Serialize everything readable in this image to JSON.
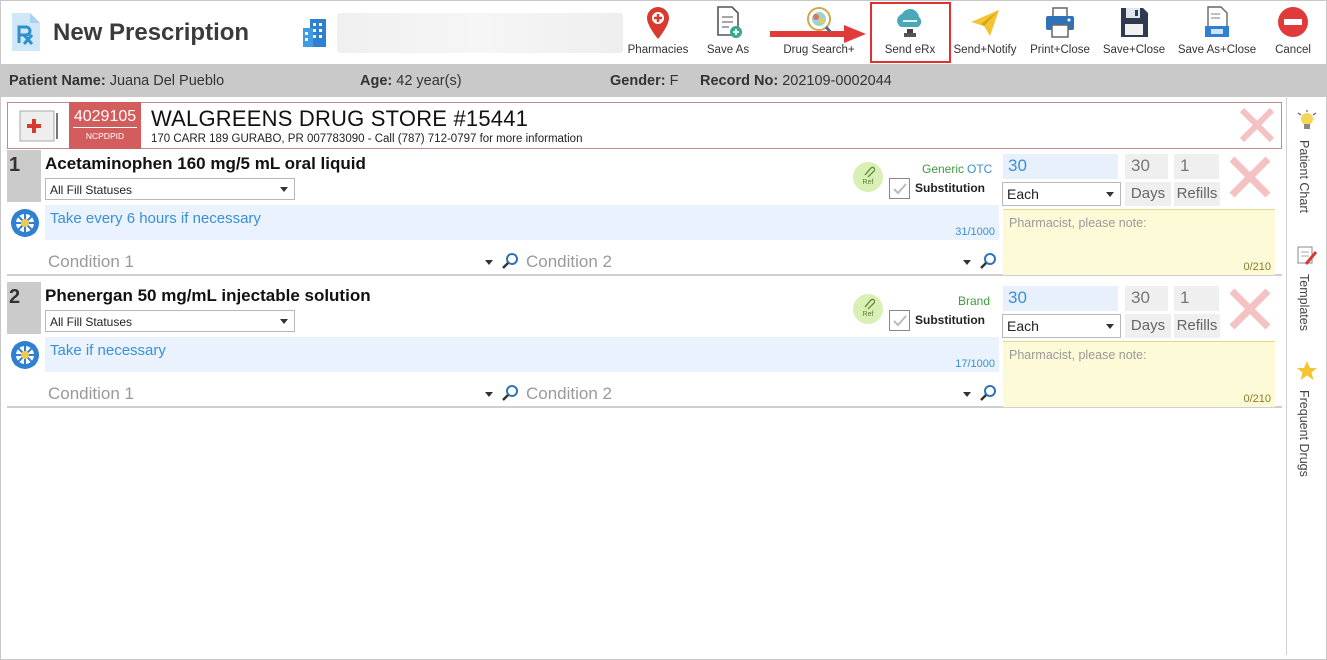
{
  "header": {
    "title": "New Prescription",
    "app_icon": "prescription-app-icon",
    "practice_icon": "building-icon"
  },
  "toolbar": [
    {
      "id": "pharmacies",
      "label": "Pharmacies",
      "icon": "location-pin-icon"
    },
    {
      "id": "save-as",
      "label": "Save As",
      "icon": "document-add-icon"
    },
    {
      "id": "drug-search",
      "label": "Drug Search+",
      "icon": "pill-search-icon"
    },
    {
      "id": "send-erx",
      "label": "Send eRx",
      "icon": "cloud-send-icon",
      "highlighted": true
    },
    {
      "id": "send-notify",
      "label": "Send+Notify",
      "icon": "paper-plane-icon"
    },
    {
      "id": "print-close",
      "label": "Print+Close",
      "icon": "printer-icon"
    },
    {
      "id": "save-close",
      "label": "Save+Close",
      "icon": "floppy-disk-icon"
    },
    {
      "id": "save-as-close",
      "label": "Save As+Close",
      "icon": "document-save-icon"
    },
    {
      "id": "cancel",
      "label": "Cancel",
      "icon": "cancel-circle-icon"
    }
  ],
  "patient": {
    "name_label": "Patient Name:",
    "name": "Juana Del Pueblo",
    "age_label": "Age:",
    "age": "42 year(s)",
    "gender_label": "Gender:",
    "gender": "F",
    "record_label": "Record No:",
    "record": "202109-0002044"
  },
  "pharmacy": {
    "ncpdp_id": "4029105",
    "ncpdp_label": "NCPDPID",
    "name": "WALGREENS DRUG STORE #15441",
    "address": "170 CARR 189 GURABO, PR 007783090 - Call (787) 712-0797 for more information"
  },
  "prescriptions": [
    {
      "number": "1",
      "drug": "Acetaminophen 160 mg/5 mL oral liquid",
      "fill_status": "All Fill Statuses",
      "sig": "Take every 6 hours if necessary",
      "sig_count": "31/1000",
      "condition1": "Condition 1",
      "condition2": "Condition 2",
      "ref_label": "Ref",
      "type_label": "Generic",
      "otc_label": "OTC",
      "substitution_label": "Substitution",
      "quantity": "30",
      "days": "30",
      "refills": "1",
      "unit": "Each",
      "days_label": "Days",
      "refills_label": "Refills",
      "note_placeholder": "Pharmacist, please note:",
      "note_count": "0/210"
    },
    {
      "number": "2",
      "drug": "Phenergan 50 mg/mL injectable solution",
      "fill_status": "All Fill Statuses",
      "sig": "Take if necessary",
      "sig_count": "17/1000",
      "condition1": "Condition 1",
      "condition2": "Condition 2",
      "ref_label": "Ref",
      "type_label": "Brand",
      "otc_label": "",
      "substitution_label": "Substitution",
      "quantity": "30",
      "days": "30",
      "refills": "1",
      "unit": "Each",
      "days_label": "Days",
      "refills_label": "Refills",
      "note_placeholder": "Pharmacist, please note:",
      "note_count": "0/210"
    }
  ],
  "side_panel": [
    {
      "label": "Patient Chart",
      "icon": "lightbulb-icon"
    },
    {
      "label": "Templates",
      "icon": "template-pencil-icon"
    },
    {
      "label": "Frequent Drugs",
      "icon": "star-icon"
    }
  ],
  "colors": {
    "accent_blue": "#3a8fd6",
    "pharmacy_red": "#d35d5d",
    "highlight_red": "#e0302f",
    "generic_green": "#3e9b3e",
    "note_yellow": "#fdfad7"
  }
}
